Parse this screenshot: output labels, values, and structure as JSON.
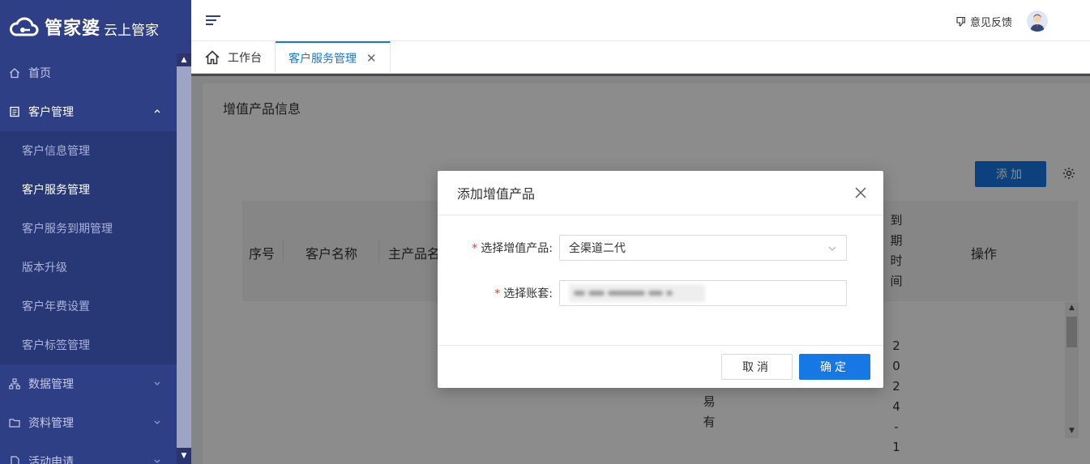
{
  "app": {
    "logo_main": "管家婆",
    "logo_sub": "云上管家"
  },
  "sidebar": {
    "items": [
      {
        "label": "首页",
        "icon": "home-icon"
      },
      {
        "label": "客户管理",
        "icon": "document-icon",
        "expanded": true
      },
      {
        "label": "数据管理",
        "icon": "sitemap-icon"
      },
      {
        "label": "资料管理",
        "icon": "folder-icon"
      },
      {
        "label": "活动申请",
        "icon": "file-icon"
      }
    ],
    "subitems": [
      {
        "label": "客户信息管理"
      },
      {
        "label": "客户服务管理",
        "active": true
      },
      {
        "label": "客户服务到期管理"
      },
      {
        "label": "版本升级"
      },
      {
        "label": "客户年费设置"
      },
      {
        "label": "客户标签管理"
      }
    ]
  },
  "header": {
    "feedback_label": "意见反馈"
  },
  "tabs": [
    {
      "label": "工作台",
      "icon": "home-icon"
    },
    {
      "label": "客户服务管理",
      "active": true,
      "closable": true
    }
  ],
  "page": {
    "section_title": "增值产品信息",
    "add_button": "添加"
  },
  "table": {
    "columns": [
      "序号",
      "客户名称",
      "主产品名",
      "到期时间",
      "操作"
    ],
    "row_partial_vertical": "贸易有",
    "date_partial": "2024-1"
  },
  "modal": {
    "title": "添加增值产品",
    "product_label": "选择增值产品:",
    "product_value": "全渠道二代",
    "account_label": "选择账套:",
    "cancel_label": "取消",
    "ok_label": "确定"
  },
  "colors": {
    "sidebar_bg": "#2f3f86",
    "primary": "#1677e5"
  }
}
